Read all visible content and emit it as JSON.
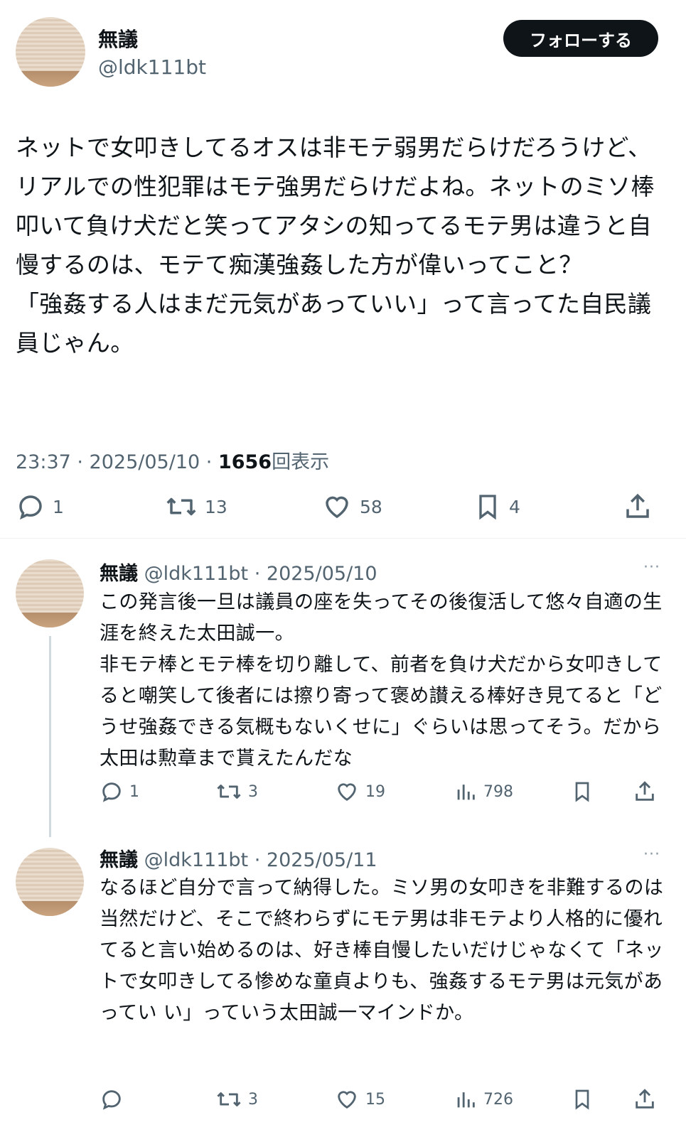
{
  "tweet": {
    "author_name": "無議",
    "handle": "@ldk111bt",
    "follow_label": "フォローする",
    "text": "ネットで女叩きしてるオスは非モテ弱男だらけだろうけど、リアルでの性犯罪はモテ強男だらけだよね。ネットのミソ棒叩いて負け犬だと笑ってアタシの知ってるモテ男は違うと自慢するのは、モテて痴漢強姦した方が偉いってこと？\n「強姦する人はまだ元気があっていい」って言ってた自民議員じゃん。",
    "time": "23:37 · 2025/05/10 · ",
    "views": "1656",
    "views_label": "回表示",
    "replies": "1",
    "retweets": "13",
    "likes": "58",
    "bookmarks": "4"
  },
  "replies": [
    {
      "author_name": "無議",
      "handle": "@ldk111bt",
      "date": "· 2025/05/10",
      "text": "この発言後一旦は議員の座を失ってその後復活して悠々自適の生涯を終えた太田誠一。\n非モテ棒とモテ棒を切り離して、前者を負け犬だから女叩きしてると嘲笑して後者には擦り寄って褒め讃える棒好き見てると「どうせ強姦できる気概もないくせに」ぐらいは思ってそう。だから太田は勲章まで貰えたんだな",
      "replies": "1",
      "retweets": "3",
      "likes": "19",
      "views": "798"
    },
    {
      "author_name": "無議",
      "handle": "@ldk111bt",
      "date": "· 2025/05/11",
      "text": "なるほど自分で言って納得した。ミソ男の女叩きを非難するのは当然だけど、そこで終わらずにモテ男は非モテより人格的に優れてると言い始めるのは、好き棒自慢したいだけじゃなくて「ネットで女叩きしてる惨めな童貞よりも、強姦するモテ男は元気があってい い」っていう太田誠一マインドか。",
      "replies": "",
      "retweets": "3",
      "likes": "15",
      "views": "726"
    }
  ],
  "more_label": "···",
  "colors": {
    "text": "#0f1419",
    "muted": "#536471",
    "button": "#0f1419",
    "divider": "#eff3f4"
  }
}
